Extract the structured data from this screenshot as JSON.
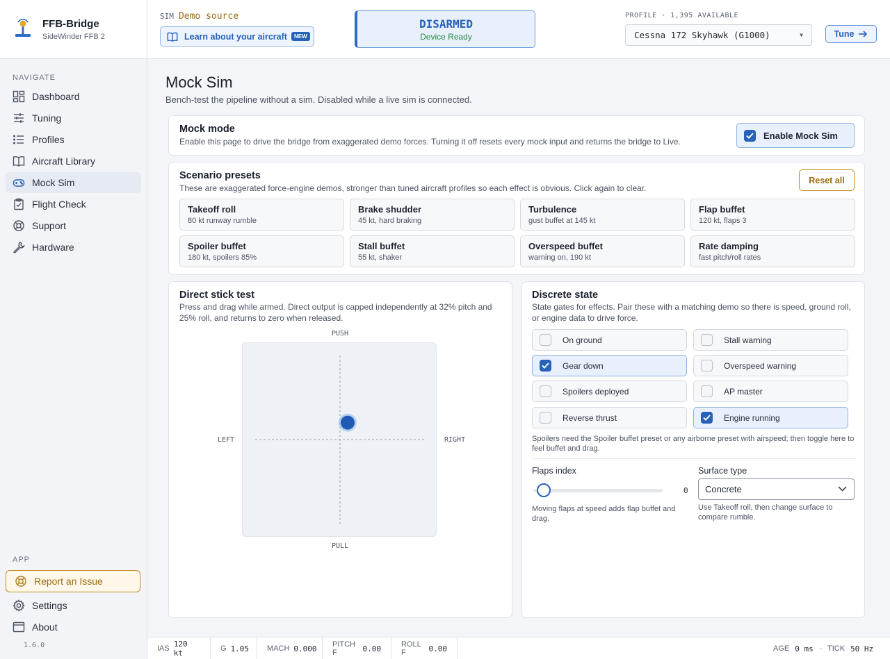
{
  "brand": {
    "title": "FFB-Bridge",
    "subtitle": "SideWinder FFB 2"
  },
  "nav": {
    "heading": "NAVIGATE",
    "items": [
      {
        "label": "Dashboard",
        "icon": "dashboard-icon"
      },
      {
        "label": "Tuning",
        "icon": "sliders-icon"
      },
      {
        "label": "Profiles",
        "icon": "list-icon"
      },
      {
        "label": "Aircraft Library",
        "icon": "book-icon"
      },
      {
        "label": "Mock Sim",
        "icon": "gamepad-icon",
        "active": true
      },
      {
        "label": "Flight Check",
        "icon": "clipboard-icon"
      },
      {
        "label": "Support",
        "icon": "lifebuoy-icon"
      },
      {
        "label": "Hardware",
        "icon": "wrench-icon"
      }
    ],
    "app_heading": "APP",
    "report_label": "Report an Issue",
    "settings_label": "Settings",
    "about_label": "About",
    "version": "1.6.0"
  },
  "topbar": {
    "sim_label": "SIM",
    "sim_value": "Demo source",
    "learn_label": "Learn about your aircraft",
    "learn_badge": "NEW",
    "arm_status": "DISARMED",
    "arm_sub": "Device Ready",
    "profile_line": "PROFILE · 1,395 AVAILABLE",
    "profile_selected": "Cessna 172 Skyhawk (G1000)",
    "tune_label": "Tune"
  },
  "page": {
    "title": "Mock Sim",
    "subtitle": "Bench-test the pipeline without a sim. Disabled while a live sim is connected."
  },
  "mock_mode": {
    "title": "Mock mode",
    "desc": "Enable this page to drive the bridge from exaggerated demo forces. Turning it off resets every mock input and returns the bridge to Live.",
    "enable_label": "Enable Mock Sim",
    "enabled": true
  },
  "presets": {
    "title": "Scenario presets",
    "desc": "These are exaggerated force-engine demos, stronger than tuned aircraft profiles so each effect is obvious. Click again to clear.",
    "reset_label": "Reset all",
    "items": [
      {
        "name": "Takeoff roll",
        "desc": "80 kt runway rumble"
      },
      {
        "name": "Brake shudder",
        "desc": "45 kt, hard braking"
      },
      {
        "name": "Turbulence",
        "desc": "gust buffet at 145 kt"
      },
      {
        "name": "Flap buffet",
        "desc": "120 kt, flaps 3"
      },
      {
        "name": "Spoiler buffet",
        "desc": "180 kt, spoilers 85%"
      },
      {
        "name": "Stall buffet",
        "desc": "55 kt, shaker"
      },
      {
        "name": "Overspeed buffet",
        "desc": "warning on, 190 kt"
      },
      {
        "name": "Rate damping",
        "desc": "fast pitch/roll rates"
      }
    ]
  },
  "stick": {
    "title": "Direct stick test",
    "desc": "Press and drag while armed. Direct output is capped independently at 32% pitch and 25% roll, and returns to zero when released.",
    "push": "PUSH",
    "pull": "PULL",
    "left": "LEFT",
    "right": "RIGHT",
    "pitch_deflection": 0.2,
    "roll_deflection": 0.09
  },
  "discrete": {
    "title": "Discrete state",
    "desc": "State gates for effects. Pair these with a matching demo so there is speed, ground roll, or engine data to drive force.",
    "items": [
      {
        "label": "On ground",
        "on": false
      },
      {
        "label": "Stall warning",
        "on": false
      },
      {
        "label": "Gear down",
        "on": true
      },
      {
        "label": "Overspeed warning",
        "on": false
      },
      {
        "label": "Spoilers deployed",
        "on": false
      },
      {
        "label": "AP master",
        "on": false
      },
      {
        "label": "Reverse thrust",
        "on": false
      },
      {
        "label": "Engine running",
        "on": true
      }
    ],
    "note": "Spoilers need the Spoiler buffet preset or any airborne preset with airspeed; then toggle here to feel buffet and drag.",
    "flaps_label": "Flaps index",
    "flaps_value": "0",
    "flaps_hint": "Moving flaps at speed adds flap buffet and drag.",
    "surface_label": "Surface type",
    "surface_value": "Concrete",
    "surface_hint": "Use Takeoff roll, then change surface to compare rumble."
  },
  "status": {
    "ias_label": "IAS",
    "ias_value": "120 kt",
    "g_label": "G",
    "g_value": "1.05",
    "mach_label": "MACH",
    "mach_value": "0.000",
    "pitch_label": "PITCH F",
    "pitch_value": "0.00",
    "roll_label": "ROLL F",
    "roll_value": "0.00",
    "age_label": "AGE",
    "age_value": "0 ms",
    "tick_label": "TICK",
    "tick_value": "50 Hz"
  },
  "colors": {
    "accent": "#2761b8",
    "warn": "#c08a1e",
    "ready": "#2a8a3e"
  }
}
